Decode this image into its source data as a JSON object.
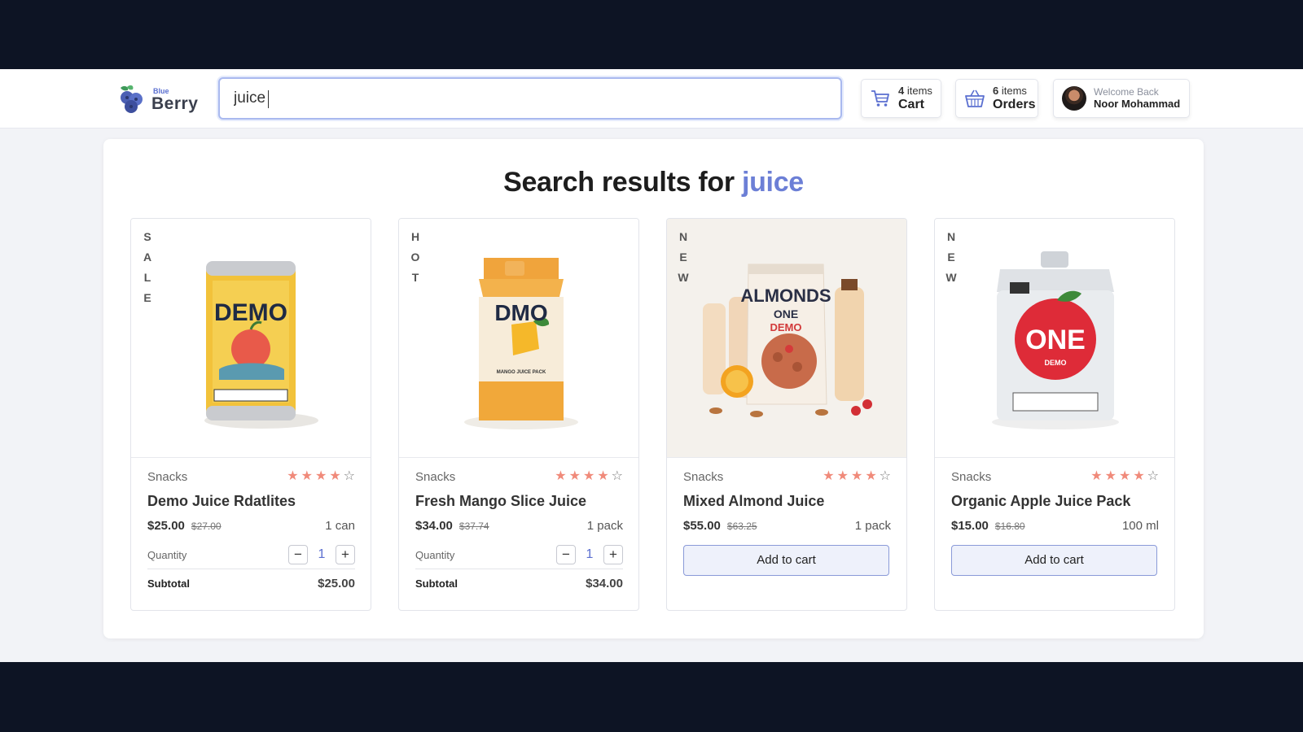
{
  "brand": {
    "small": "Blue",
    "big": "Berry"
  },
  "search": {
    "value": "juice"
  },
  "cart": {
    "count": "4",
    "count_suffix": "items",
    "label": "Cart"
  },
  "orders": {
    "count": "6",
    "count_suffix": "items",
    "label": "Orders"
  },
  "user": {
    "greeting": "Welcome Back",
    "name": "Noor Mohammad"
  },
  "results": {
    "title_prefix": "Search results for",
    "query": "juice"
  },
  "products": [
    {
      "badge": "SALE",
      "category": "Snacks",
      "rating": 4,
      "name": "Demo Juice Rdatlites",
      "price": "$25.00",
      "old_price": "$27.00",
      "unit": "1 can",
      "quantity_label": "Quantity",
      "quantity": "1",
      "subtotal_label": "Subtotal",
      "subtotal": "$25.00",
      "image_label": "DEMO"
    },
    {
      "badge": "HOT",
      "category": "Snacks",
      "rating": 4,
      "name": "Fresh Mango Slice Juice",
      "price": "$34.00",
      "old_price": "$37.74",
      "unit": "1 pack",
      "quantity_label": "Quantity",
      "quantity": "1",
      "subtotal_label": "Subtotal",
      "subtotal": "$34.00",
      "image_label": "DMO",
      "image_sub": "MANGO JUICE PACK"
    },
    {
      "badge": "NEW",
      "category": "Snacks",
      "rating": 4,
      "name": "Mixed Almond Juice",
      "price": "$55.00",
      "old_price": "$63.25",
      "unit": "1 pack",
      "button": "Add to cart",
      "image_label": "ALMONDS",
      "image_sub": "ONE",
      "image_sub2": "DEMO"
    },
    {
      "badge": "NEW",
      "category": "Snacks",
      "rating": 4,
      "name": "Organic Apple Juice Pack",
      "price": "$15.00",
      "old_price": "$16.80",
      "unit": "100 ml",
      "button": "Add to cart",
      "image_label": "ONE",
      "image_sub": "DEMO"
    }
  ],
  "colors": {
    "accent": "#6c7fd6",
    "star": "#f08a7a",
    "backdrop": "#0d1424"
  }
}
